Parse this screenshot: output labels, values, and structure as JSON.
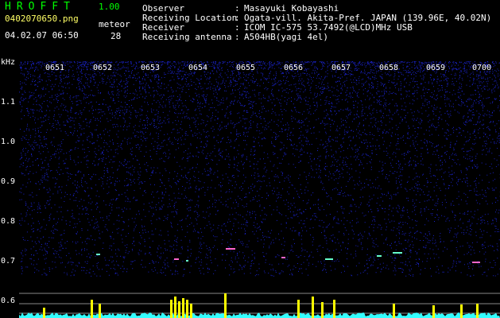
{
  "header": {
    "app_title": "HROFFT",
    "version": "1.00",
    "filename": "0402070650.png",
    "datetime": "04.02.07 06:50",
    "meteor_label": "meteor",
    "meteor_count": "28"
  },
  "info": [
    {
      "label": "Observer",
      "value": "Masayuki Kobayashi"
    },
    {
      "label": "Receiving Location",
      "value": "Ogata-vill. Akita-Pref. JAPAN (139.96E, 40.02N)"
    },
    {
      "label": "Receiver",
      "value": "ICOM IC-575 53.7492(@LCD)MHz USB"
    },
    {
      "label": "Receiving antenna",
      "value": "A504HB(yagi 4el)"
    }
  ],
  "info_colon": ":",
  "chart_data": {
    "type": "heatmap",
    "ylabel": "kHz",
    "yticks": [
      "1.1",
      "1.0",
      "0.9",
      "0.8",
      "0.7",
      "0.6"
    ],
    "xticks": [
      "0651",
      "0652",
      "0653",
      "0654",
      "0655",
      "0656",
      "0657",
      "0658",
      "0659",
      "0700"
    ],
    "colors": {
      "background": "#000000",
      "noise": "#1a22c8",
      "signal": "#ffff00",
      "spectrum": "#33ffff"
    }
  }
}
